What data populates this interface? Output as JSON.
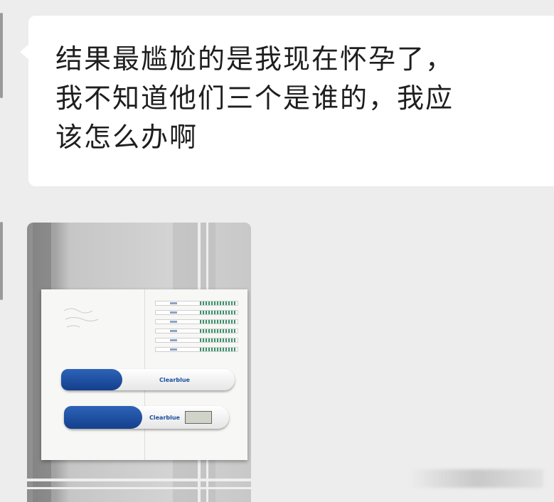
{
  "message": {
    "text": "结果最尴尬的是我现在怀孕了，\n我不知道他们三个是谁的，我应\n该怎么办啊"
  },
  "photo": {
    "brand_label": "Clearblue",
    "strip_numbers": [
      "7",
      "8",
      "9",
      "10",
      "11",
      "12"
    ]
  },
  "colors": {
    "chat_background": "#ededed",
    "bubble": "#ffffff",
    "text": "#1e1e1e",
    "cap_blue": "#1f4fa0"
  }
}
